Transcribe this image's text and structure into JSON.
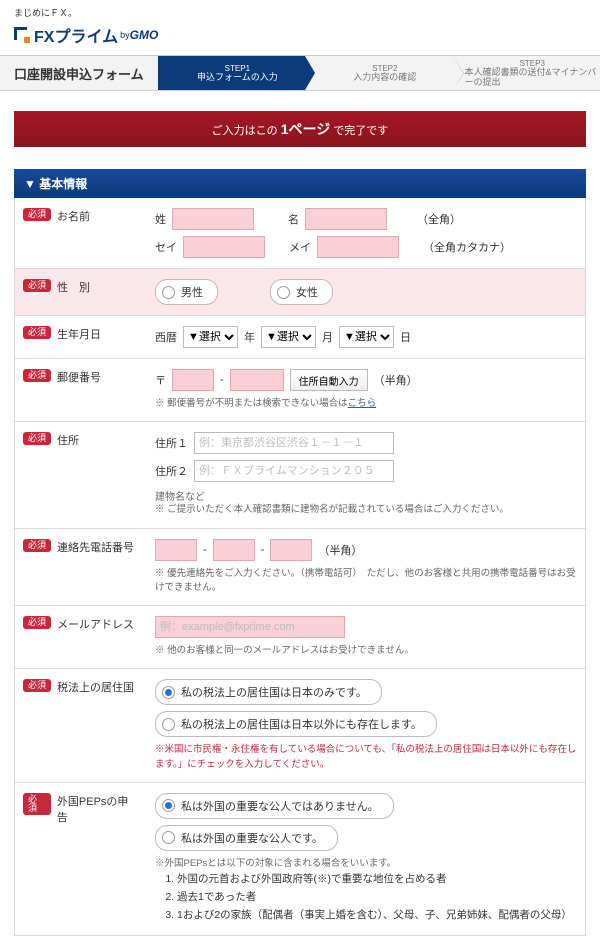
{
  "tagline": "まじめにＦＸ。",
  "logo_text": "FXプライム",
  "logo_by": "by",
  "logo_gmo": "GMO",
  "form_title": "口座開設申込フォーム",
  "steps": [
    {
      "num": "STEP1",
      "label": "申込フォームの入力"
    },
    {
      "num": "STEP2",
      "label": "入力内容の確認"
    },
    {
      "num": "STEP3",
      "label": "本人確認書類の送付&マイナンバーの提出"
    }
  ],
  "ribbon_pre": "ご入力はこの",
  "ribbon_page": "1ページ",
  "ribbon_post": "で完了です",
  "sec_title": "▼ 基本情報",
  "req": "必須",
  "labels": {
    "name": "お名前",
    "gender": "性　別",
    "dob": "生年月日",
    "zip": "郵便番号",
    "addr": "住所",
    "phone": "連絡先電話番号",
    "email": "メールアドレス",
    "tax": "税法上の居住国",
    "peps": "外国PEPsの申告"
  },
  "name": {
    "sei": "姓",
    "mei": "名",
    "seik": "セイ",
    "meik": "メイ",
    "full": "（全角）",
    "fullk": "（全角カタカナ）"
  },
  "gender": {
    "m": "男性",
    "f": "女性"
  },
  "dob": {
    "era": "西暦",
    "sel": "▼選択",
    "y": "年",
    "m": "月",
    "d": "日"
  },
  "zip": {
    "mark": "〒",
    "dash": "-",
    "btn": "住所自動入力",
    "han": "（半角）",
    "note": "※ 郵便番号が不明または検索できない場合は",
    "link": "こちら"
  },
  "addr": {
    "l1": "住所１",
    "p1": "例：東京都渋谷区渋谷１－１－１",
    "l2": "住所２",
    "p2": "例：ＦＸプライムマンション２０５",
    "sub": "建物名など",
    "note": "※ ご提示いただく本人確認書類に建物名が記載されている場合はご入力ください。"
  },
  "phone": {
    "dash": "-",
    "han": "（半角）",
    "note": "※ 優先連絡先をご入力ください。（携帯電話可）　ただし、他のお客様と共用の携帯電話番号はお受けできません。"
  },
  "email": {
    "ph": "例：example@fxprime.com",
    "note": "※ 他のお客様と同一のメールアドレスはお受けできません。"
  },
  "tax": {
    "o1": "私の税法上の居住国は日本のみです。",
    "o2": "私の税法上の居住国は日本以外にも存在します。",
    "note": "※米国に市民権・永住権を有している場合についても、「私の税法上の居住国は日本以外にも存在します。」にチェックを入力してください。"
  },
  "peps": {
    "o1": "私は外国の重要な公人ではありません。",
    "o2": "私は外国の重要な公人です。",
    "note": "※外国PEPsとは以下の対象に含まれる場合をいいます。",
    "li1": "外国の元首および外国政府等(※)で重要な地位を占める者",
    "li2": "過去1であった者",
    "li3": "1および2の家族（配偶者（事実上婚を含む）、父母、子、兄弟姉妹、配偶者の父母）"
  }
}
